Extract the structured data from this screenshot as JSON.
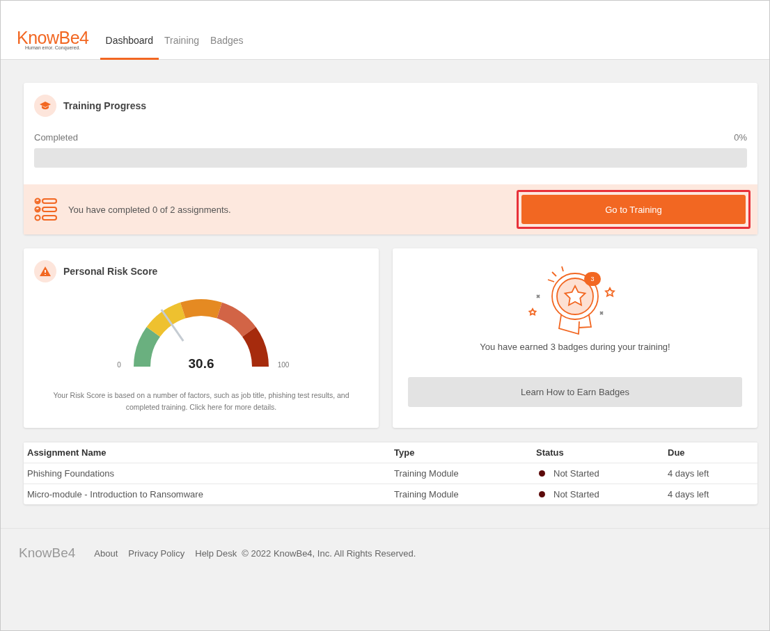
{
  "header": {
    "logo": "KnowBe4",
    "tagline": "Human error. Conquered.",
    "tabs": [
      {
        "label": "Dashboard",
        "selected": true
      },
      {
        "label": "Training",
        "selected": false
      },
      {
        "label": "Badges",
        "selected": false
      }
    ]
  },
  "training_progress": {
    "title": "Training Progress",
    "label": "Completed",
    "percent": "0%",
    "level": 0,
    "message": "You have completed 0 of 2 assignments.",
    "button": "Go to Training",
    "highlighted": true
  },
  "risk_score": {
    "title": "Personal Risk Score",
    "score": "30.6",
    "level": 0.306,
    "min": "0",
    "max": "100",
    "description": "Your Risk Score is based on a number of factors, such as job title, phishing test results, and completed training. Click here for more details."
  },
  "badges": {
    "count": "3",
    "message": "You have earned 3 badges during your training!",
    "button": "Learn How to Earn Badges"
  },
  "table": {
    "columns": [
      "Assignment Name",
      "Type",
      "Status",
      "Due"
    ],
    "rows": [
      {
        "name": "Phishing Foundations",
        "type": "Training Module",
        "status": "Not Started",
        "color": "#5c0a0a",
        "due": "4 days left"
      },
      {
        "name": "Micro-module - Introduction to Ransomware",
        "type": "Training Module",
        "status": "Not Started",
        "color": "#5c0a0a",
        "due": "4 days left"
      }
    ]
  },
  "footer": {
    "logo": "KnowBe4",
    "links": [
      "About",
      "Privacy Policy",
      "Help Desk"
    ],
    "copyright": "© 2022 KnowBe4, Inc. All Rights Reserved."
  }
}
